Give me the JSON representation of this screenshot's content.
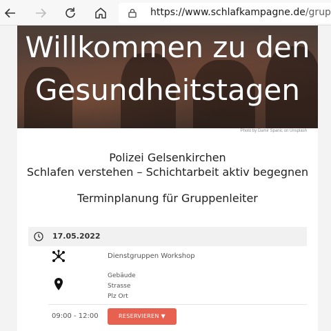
{
  "browser": {
    "url_host": "https://www.schlafkampagne.de",
    "url_path": "/grupper"
  },
  "hero": {
    "title_line1": "Willkommen zu den",
    "title_line2": "Gesundheitstagen",
    "photo_credit": "Photo by Damir Spanic on Unsplash"
  },
  "intro": {
    "organization": "Polizei Gelsenkirchen",
    "tagline": "Schlafen verstehen – Schichtarbeit aktiv begegnen",
    "subtitle": "Terminplanung für Gruppenleiter"
  },
  "event": {
    "date": "17.05.2022",
    "title": "Dienstgruppen Workshop",
    "location": [
      "Gebäude",
      "Strasse",
      "Plz Ort"
    ],
    "time": "09:00 - 12:00",
    "reserve_label": "RESERVIEREN ▼"
  },
  "colors": {
    "accent": "#e8604f",
    "date_bar": "#f1f1f1"
  }
}
